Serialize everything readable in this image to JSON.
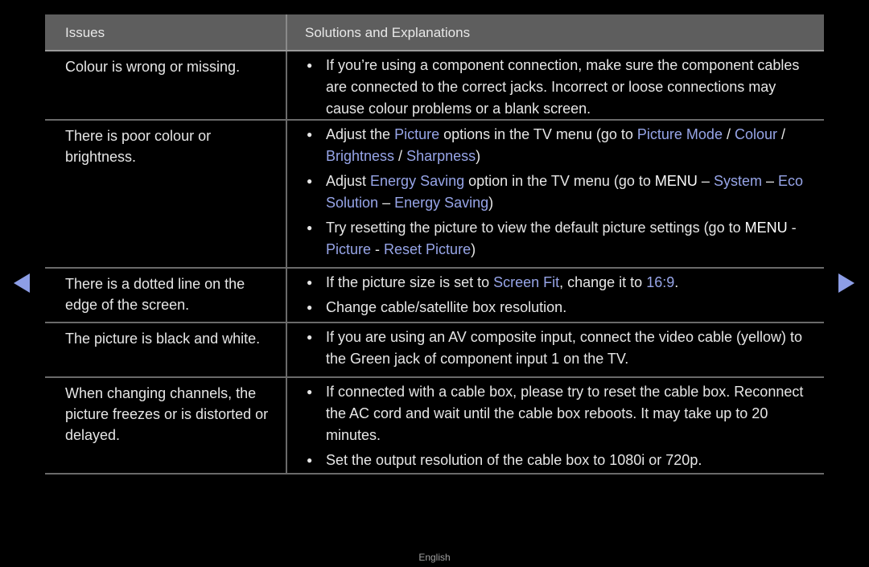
{
  "header": {
    "issues": "Issues",
    "solutions": "Solutions and Explanations"
  },
  "rows": [
    {
      "issue": "Colour is wrong or missing.",
      "solutions": [
        [
          {
            "t": "If you’re using a component connection, make sure the component cables are connected to the correct jacks. Incorrect or loose connections may cause colour problems or a blank screen."
          }
        ]
      ]
    },
    {
      "issue": "There is poor colour or brightness.",
      "solutions": [
        [
          {
            "t": "Adjust the "
          },
          {
            "t": "Picture",
            "s": "hl"
          },
          {
            "t": " options in the TV menu (go to "
          },
          {
            "t": "Picture Mode",
            "s": "hl"
          },
          {
            "t": " / "
          },
          {
            "t": "Colour",
            "s": "hl"
          },
          {
            "t": " / "
          },
          {
            "t": "Brightness",
            "s": "hl"
          },
          {
            "t": " / "
          },
          {
            "t": "Sharpness",
            "s": "hl"
          },
          {
            "t": ")"
          }
        ],
        [
          {
            "t": "Adjust "
          },
          {
            "t": "Energy Saving",
            "s": "hl"
          },
          {
            "t": " option in the TV menu (go to "
          },
          {
            "t": "MENU",
            "s": "bold"
          },
          {
            "t": " – "
          },
          {
            "t": "System",
            "s": "hl"
          },
          {
            "t": " – "
          },
          {
            "t": "Eco Solution",
            "s": "hl"
          },
          {
            "t": " – "
          },
          {
            "t": "Energy Saving",
            "s": "hl"
          },
          {
            "t": ")"
          }
        ],
        [
          {
            "t": "Try resetting the picture to view the default picture settings (go to "
          },
          {
            "t": "MENU",
            "s": "bold"
          },
          {
            "t": " - "
          },
          {
            "t": "Picture",
            "s": "hl"
          },
          {
            "t": " - "
          },
          {
            "t": "Reset Picture",
            "s": "hl"
          },
          {
            "t": ")"
          }
        ]
      ]
    },
    {
      "issue": "There is a dotted line on the edge of the screen.",
      "solutions": [
        [
          {
            "t": "If the picture size is set to "
          },
          {
            "t": "Screen Fit",
            "s": "hl"
          },
          {
            "t": ", change it to "
          },
          {
            "t": "16:9",
            "s": "hl"
          },
          {
            "t": "."
          }
        ],
        [
          {
            "t": "Change cable/satellite box resolution."
          }
        ]
      ]
    },
    {
      "issue": "The picture is black and white.",
      "solutions": [
        [
          {
            "t": "If you are using an AV composite input, connect the video cable (yellow) to the Green jack of component input 1 on the TV."
          }
        ]
      ]
    },
    {
      "issue": "When changing channels, the picture freezes or is distorted or delayed.",
      "solutions": [
        [
          {
            "t": "If connected with a cable box, please try to reset the cable box. Reconnect the AC cord and wait until the cable box reboots. It may take up to 20 minutes."
          }
        ],
        [
          {
            "t": "Set the output resolution of the cable box to 1080i or 720p."
          }
        ]
      ]
    }
  ],
  "nav": {
    "prev_icon": "left-triangle-arrow-icon",
    "next_icon": "right-triangle-arrow-icon"
  },
  "footer": {
    "language": "English"
  },
  "colors": {
    "highlight": "#97a5e8",
    "header_bg": "#5e5e5e",
    "arrow": "#8d9ee6"
  }
}
